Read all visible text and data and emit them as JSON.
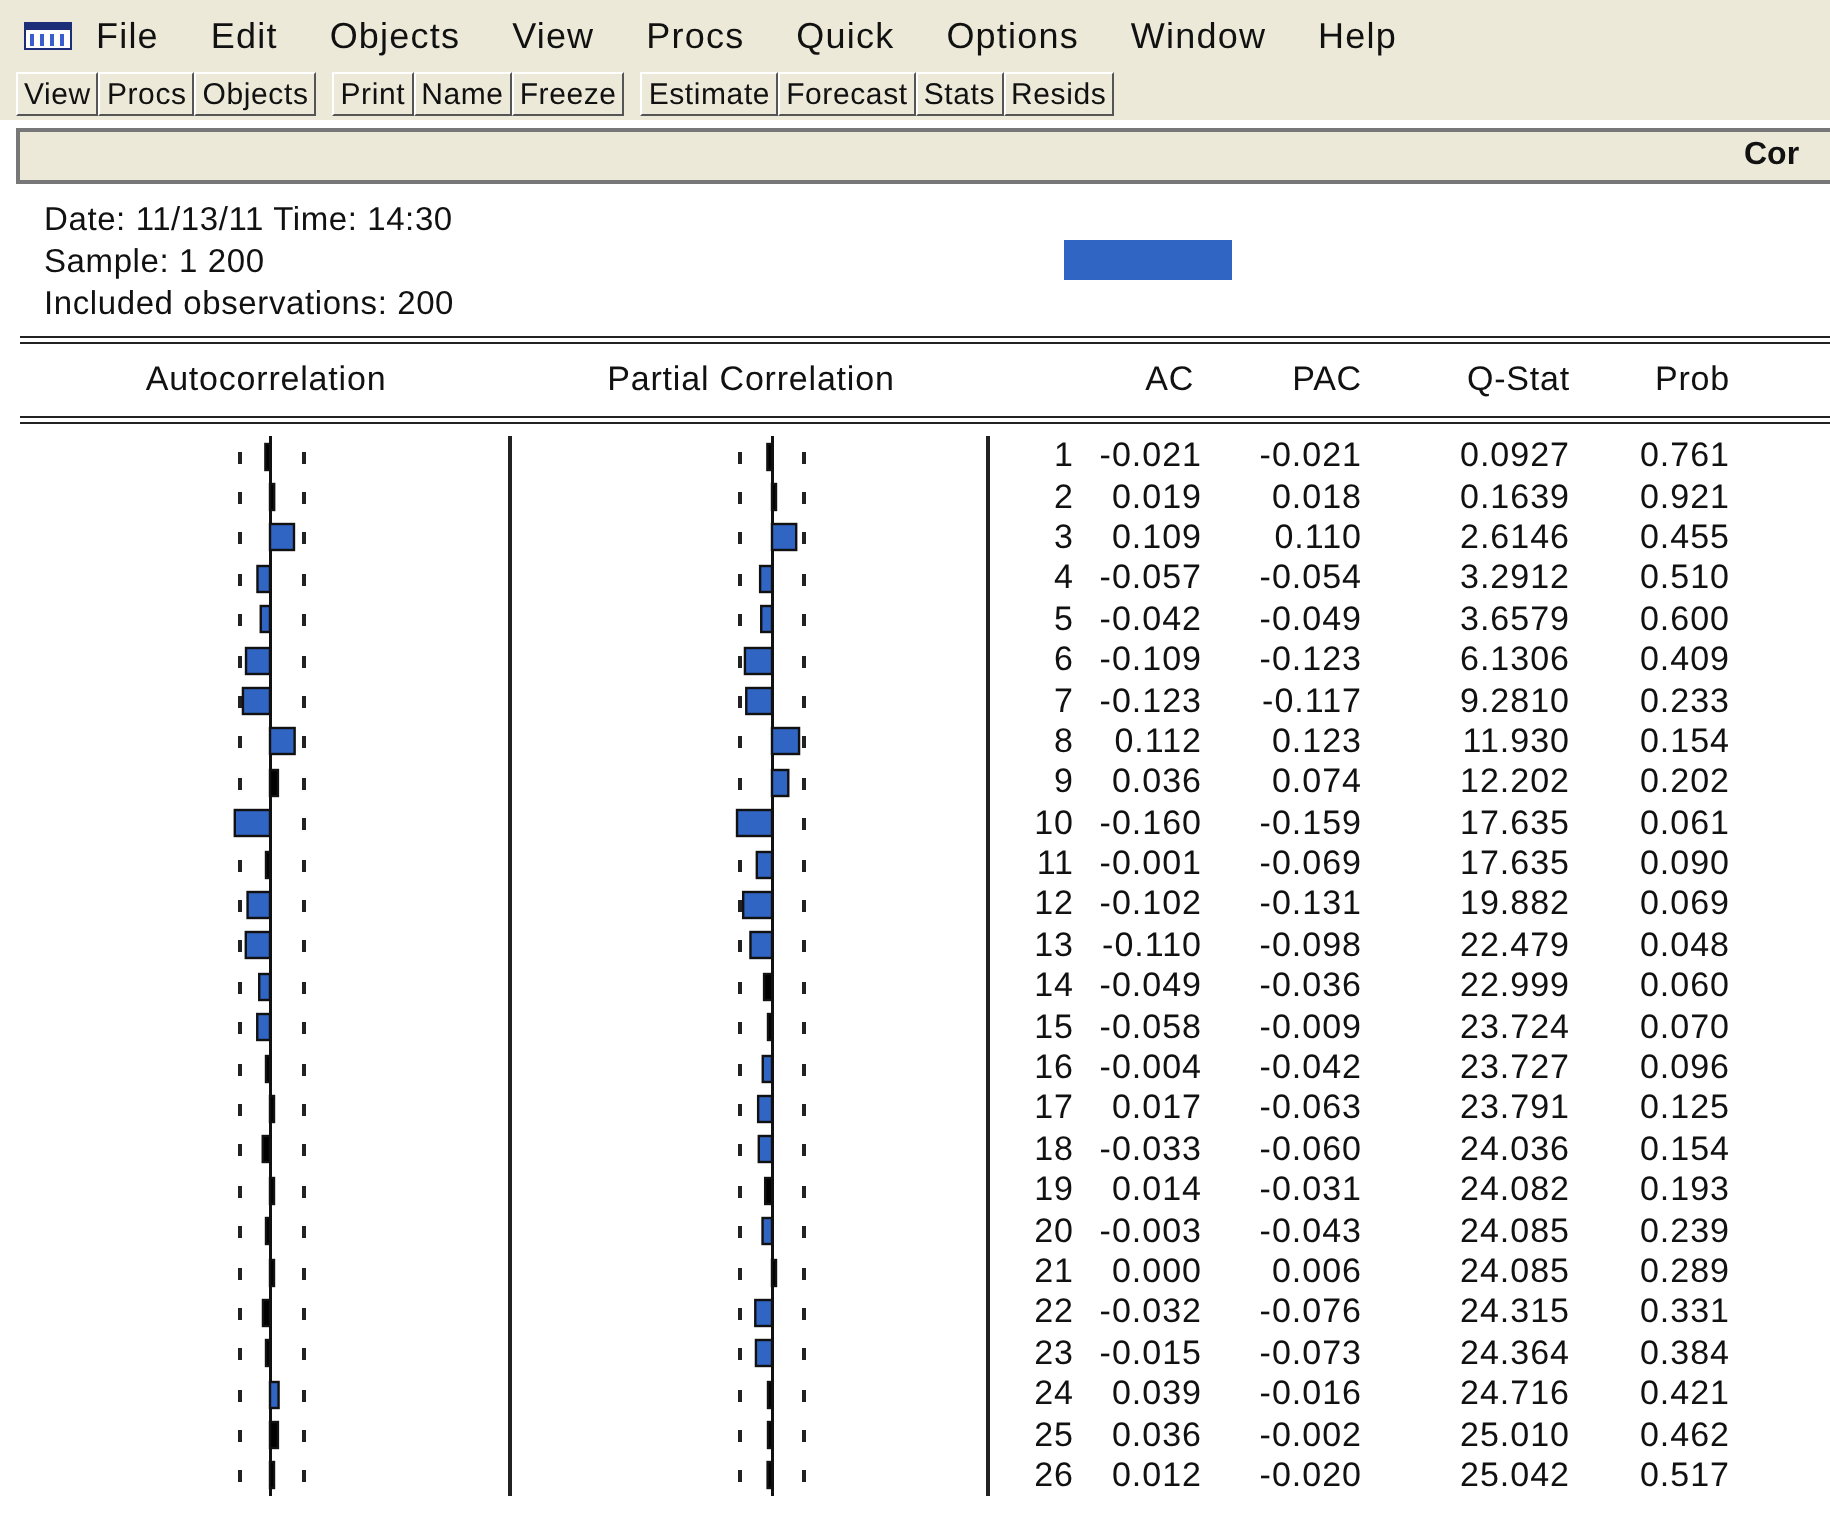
{
  "menu": [
    "File",
    "Edit",
    "Objects",
    "View",
    "Procs",
    "Quick",
    "Options",
    "Window",
    "Help"
  ],
  "toolbar": [
    [
      "View",
      "Procs",
      "Objects"
    ],
    [
      "Print",
      "Name",
      "Freeze"
    ],
    [
      "Estimate",
      "Forecast",
      "Stats",
      "Resids"
    ]
  ],
  "title_bar": {
    "title": "Cor"
  },
  "info": [
    "Date: 11/13/11   Time: 14:30",
    "Sample: 1 200",
    "Included observations: 200"
  ],
  "columns": [
    "Autocorrelation",
    "Partial Correlation",
    "",
    "AC",
    "PAC",
    "Q-Stat",
    "Prob"
  ],
  "rows": [
    [
      "1",
      "-0.021",
      "-0.021",
      "0.0927",
      "0.761"
    ],
    [
      "2",
      "0.019",
      "0.018",
      "0.1639",
      "0.921"
    ],
    [
      "3",
      "0.109",
      "0.110",
      "2.6146",
      "0.455"
    ],
    [
      "4",
      "-0.057",
      "-0.054",
      "3.2912",
      "0.510"
    ],
    [
      "5",
      "-0.042",
      "-0.049",
      "3.6579",
      "0.600"
    ],
    [
      "6",
      "-0.109",
      "-0.123",
      "6.1306",
      "0.409"
    ],
    [
      "7",
      "-0.123",
      "-0.117",
      "9.2810",
      "0.233"
    ],
    [
      "8",
      "0.112",
      "0.123",
      "11.930",
      "0.154"
    ],
    [
      "9",
      "0.036",
      "0.074",
      "12.202",
      "0.202"
    ],
    [
      "10",
      "-0.160",
      "-0.159",
      "17.635",
      "0.061"
    ],
    [
      "11",
      "-0.001",
      "-0.069",
      "17.635",
      "0.090"
    ],
    [
      "12",
      "-0.102",
      "-0.131",
      "19.882",
      "0.069"
    ],
    [
      "13",
      "-0.110",
      "-0.098",
      "22.479",
      "0.048"
    ],
    [
      "14",
      "-0.049",
      "-0.036",
      "22.999",
      "0.060"
    ],
    [
      "15",
      "-0.058",
      "-0.009",
      "23.724",
      "0.070"
    ],
    [
      "16",
      "-0.004",
      "-0.042",
      "23.727",
      "0.096"
    ],
    [
      "17",
      "0.017",
      "-0.063",
      "23.791",
      "0.125"
    ],
    [
      "18",
      "-0.033",
      "-0.060",
      "24.036",
      "0.154"
    ],
    [
      "19",
      "0.014",
      "-0.031",
      "24.082",
      "0.193"
    ],
    [
      "20",
      "-0.003",
      "-0.043",
      "24.085",
      "0.239"
    ],
    [
      "21",
      "0.000",
      "0.006",
      "24.085",
      "0.289"
    ],
    [
      "22",
      "-0.032",
      "-0.076",
      "24.315",
      "0.331"
    ],
    [
      "23",
      "-0.015",
      "-0.073",
      "24.364",
      "0.384"
    ],
    [
      "24",
      "0.039",
      "-0.016",
      "24.716",
      "0.421"
    ],
    [
      "25",
      "0.036",
      "-0.002",
      "25.010",
      "0.462"
    ],
    [
      "26",
      "0.012",
      "-0.020",
      "25.042",
      "0.517"
    ]
  ]
}
